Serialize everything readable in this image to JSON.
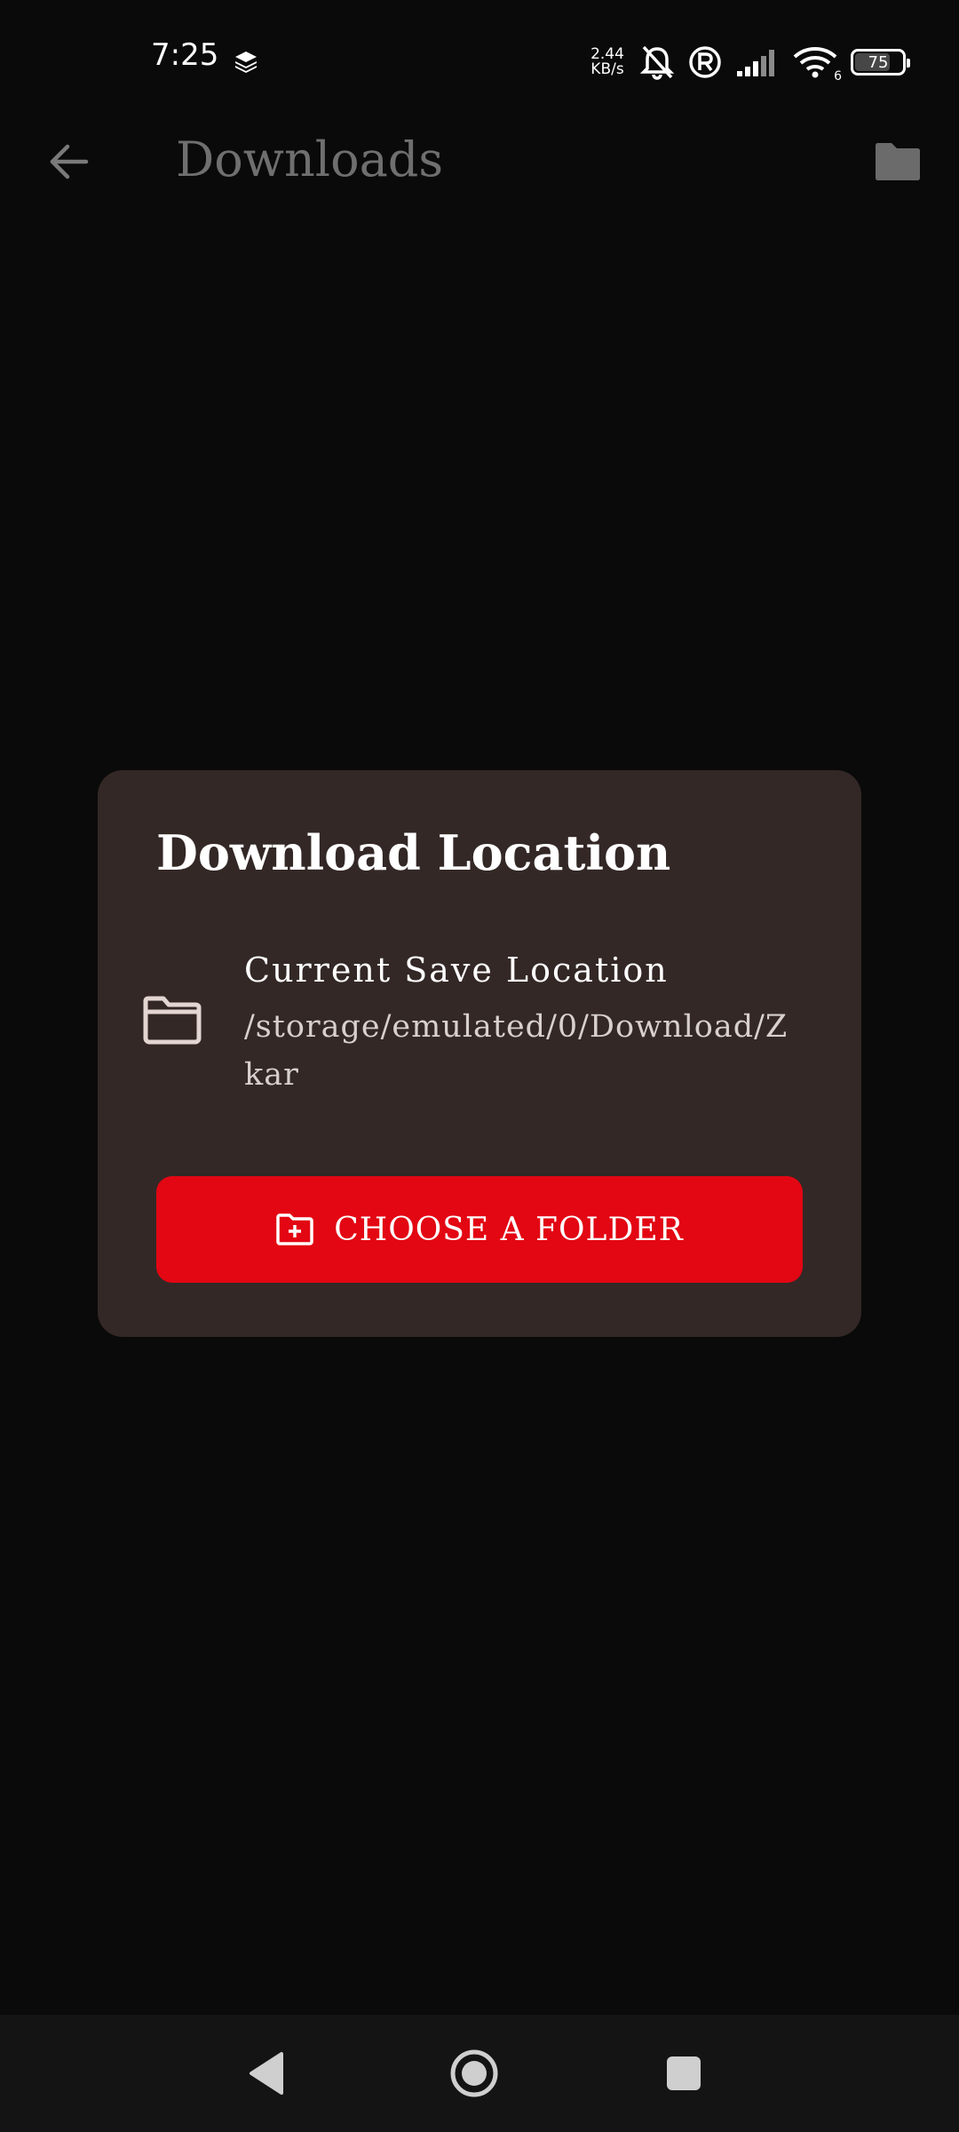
{
  "status_bar": {
    "time": "7:25",
    "net_speed_value": "2.44",
    "net_speed_unit": "KB/s",
    "battery": "75",
    "battery_level": 0.75,
    "wifi_badge": "6"
  },
  "app_bar": {
    "title": "Downloads"
  },
  "dialog": {
    "title": "Download Location",
    "location_label": "Current Save Location",
    "location_path": "/storage/emulated/0/Download/Zkar",
    "button_label": "CHOOSE A FOLDER"
  },
  "colors": {
    "background": "#0a0a0a",
    "dialog": "#332826",
    "accent": "#e30613",
    "title_muted": "#6f6f6f",
    "nav_bar": "#141414"
  },
  "icons": {
    "back": "arrow-left-icon",
    "folder": "folder-icon",
    "location": "folder-outline-icon",
    "button": "folder-plus-icon",
    "nav_back": "triangle-back-icon",
    "nav_home": "circle-home-icon",
    "nav_recents": "square-recents-icon"
  }
}
